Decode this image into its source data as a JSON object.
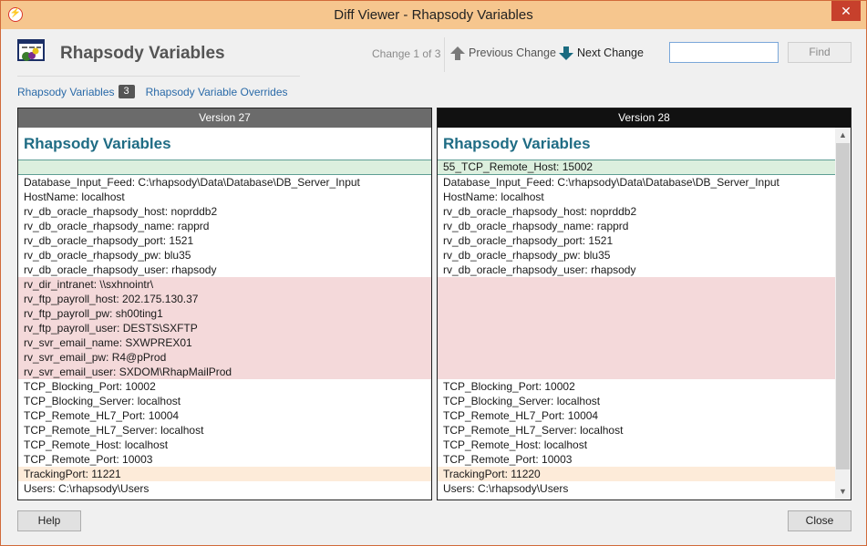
{
  "window": {
    "title": "Diff Viewer - Rhapsody Variables",
    "close_glyph": "✕"
  },
  "header": {
    "title": "Rhapsody Variables",
    "change_counter": "Change 1 of 3",
    "previous_label": "Previous Change",
    "next_label": "Next Change"
  },
  "search": {
    "value": "",
    "find_label": "Find"
  },
  "tabs": [
    {
      "label": "Rhapsody Variables",
      "badge": "3"
    },
    {
      "label": "Rhapsody Variable Overrides"
    }
  ],
  "colors": {
    "title_bar": "#f6c68e",
    "changed_row": "#dcefde",
    "removed_row": "#f4d9da",
    "modified_row": "#fdebd9",
    "heading": "#1f6c84",
    "link": "#2a6aa8"
  },
  "left_pane": {
    "header": "Version 27",
    "title": "Rhapsody Variables",
    "rows": [
      {
        "text": "",
        "status": "changed"
      },
      {
        "text": "Database_Input_Feed: C:\\rhapsody\\Data\\Database\\DB_Server_Input",
        "status": "normal"
      },
      {
        "text": "HostName: localhost",
        "status": "normal"
      },
      {
        "text": "rv_db_oracle_rhapsody_host: noprddb2",
        "status": "normal"
      },
      {
        "text": "rv_db_oracle_rhapsody_name: rapprd",
        "status": "normal"
      },
      {
        "text": "rv_db_oracle_rhapsody_port: 1521",
        "status": "normal"
      },
      {
        "text": "rv_db_oracle_rhapsody_pw: blu35",
        "status": "normal"
      },
      {
        "text": "rv_db_oracle_rhapsody_user: rhapsody",
        "status": "normal"
      },
      {
        "text": "rv_dir_intranet: \\\\sxhnointr\\",
        "status": "removed"
      },
      {
        "text": "rv_ftp_payroll_host: 202.175.130.37",
        "status": "removed"
      },
      {
        "text": "rv_ftp_payroll_pw: sh00ting1",
        "status": "removed"
      },
      {
        "text": "rv_ftp_payroll_user: DESTS\\SXFTP",
        "status": "removed"
      },
      {
        "text": "rv_svr_email_name: SXWPREX01",
        "status": "removed"
      },
      {
        "text": "rv_svr_email_pw: R4@pProd",
        "status": "removed"
      },
      {
        "text": "rv_svr_email_user: SXDOM\\RhapMailProd",
        "status": "removed"
      },
      {
        "text": "TCP_Blocking_Port: 10002",
        "status": "normal"
      },
      {
        "text": "TCP_Blocking_Server: localhost",
        "status": "normal"
      },
      {
        "text": "TCP_Remote_HL7_Port: 10004",
        "status": "normal"
      },
      {
        "text": "TCP_Remote_HL7_Server: localhost",
        "status": "normal"
      },
      {
        "text": "TCP_Remote_Host: localhost",
        "status": "normal"
      },
      {
        "text": "TCP_Remote_Port: 10003",
        "status": "normal"
      },
      {
        "text": "TrackingPort: 11221",
        "status": "modified"
      },
      {
        "text": "Users: C:\\rhapsody\\Users",
        "status": "normal"
      }
    ]
  },
  "right_pane": {
    "header": "Version 28",
    "title": "Rhapsody Variables",
    "rows": [
      {
        "text": "55_TCP_Remote_Host: 15002",
        "status": "changed"
      },
      {
        "text": "Database_Input_Feed: C:\\rhapsody\\Data\\Database\\DB_Server_Input",
        "status": "normal"
      },
      {
        "text": "HostName: localhost",
        "status": "normal"
      },
      {
        "text": "rv_db_oracle_rhapsody_host: noprddb2",
        "status": "normal"
      },
      {
        "text": "rv_db_oracle_rhapsody_name: rapprd",
        "status": "normal"
      },
      {
        "text": "rv_db_oracle_rhapsody_port: 1521",
        "status": "normal"
      },
      {
        "text": "rv_db_oracle_rhapsody_pw: blu35",
        "status": "normal"
      },
      {
        "text": "rv_db_oracle_rhapsody_user: rhapsody",
        "status": "normal"
      },
      {
        "text": "",
        "status": "removed"
      },
      {
        "text": "",
        "status": "removed"
      },
      {
        "text": "",
        "status": "removed"
      },
      {
        "text": "",
        "status": "removed"
      },
      {
        "text": "",
        "status": "removed"
      },
      {
        "text": "",
        "status": "removed"
      },
      {
        "text": "",
        "status": "removed"
      },
      {
        "text": "TCP_Blocking_Port: 10002",
        "status": "normal"
      },
      {
        "text": "TCP_Blocking_Server: localhost",
        "status": "normal"
      },
      {
        "text": "TCP_Remote_HL7_Port: 10004",
        "status": "normal"
      },
      {
        "text": "TCP_Remote_HL7_Server: localhost",
        "status": "normal"
      },
      {
        "text": "TCP_Remote_Host: localhost",
        "status": "normal"
      },
      {
        "text": "TCP_Remote_Port: 10003",
        "status": "normal"
      },
      {
        "text": "TrackingPort: 11220",
        "status": "modified"
      },
      {
        "text": "Users: C:\\rhapsody\\Users",
        "status": "normal"
      }
    ]
  },
  "footer": {
    "help_label": "Help",
    "close_label": "Close"
  }
}
